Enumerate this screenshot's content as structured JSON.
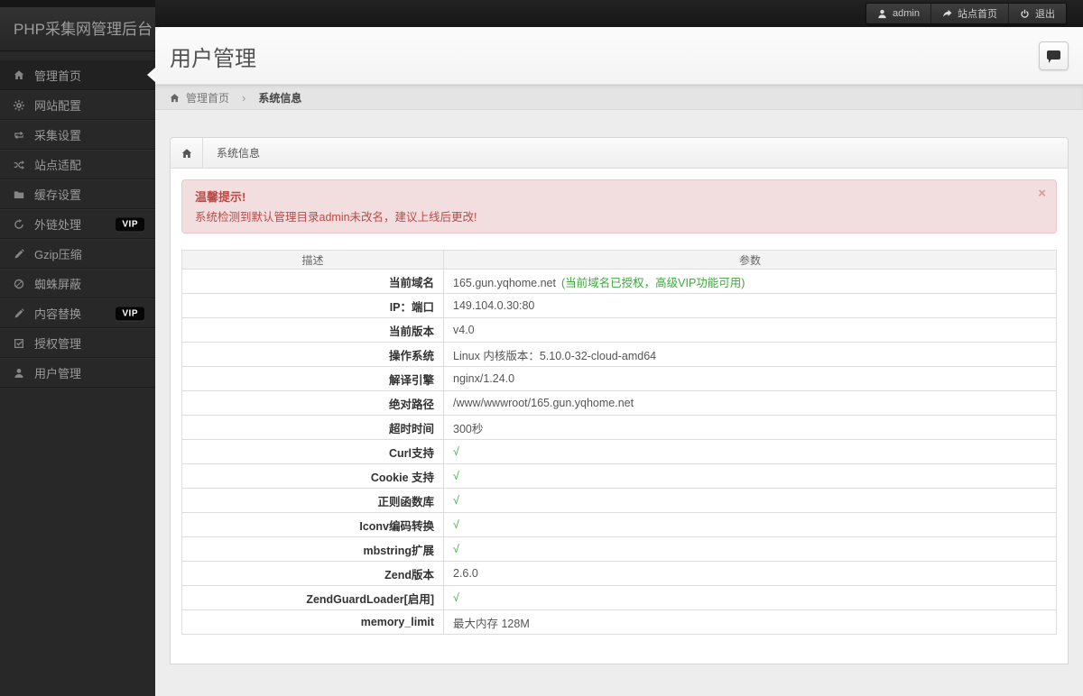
{
  "topbar": {
    "logo": "PHP采集网管理后台",
    "buttons": [
      {
        "label": "admin",
        "icon": "user-icon"
      },
      {
        "label": "站点首页",
        "icon": "share-icon"
      },
      {
        "label": "退出",
        "icon": "power-icon"
      }
    ]
  },
  "sidebar": {
    "items": [
      {
        "label": "管理首页",
        "icon": "home-icon",
        "active": true
      },
      {
        "label": "网站配置",
        "icon": "gear-icon"
      },
      {
        "label": "采集设置",
        "icon": "collect-icon"
      },
      {
        "label": "站点适配",
        "icon": "shuffle-icon"
      },
      {
        "label": "缓存设置",
        "icon": "folder-icon"
      },
      {
        "label": "外链处理",
        "icon": "refresh-icon",
        "badge": "VIP"
      },
      {
        "label": "Gzip压缩",
        "icon": "pencil-icon"
      },
      {
        "label": "蜘蛛屏蔽",
        "icon": "spider-block-icon"
      },
      {
        "label": "内容替换",
        "icon": "edit-icon",
        "badge": "VIP"
      },
      {
        "label": "授权管理",
        "icon": "license-icon"
      },
      {
        "label": "用户管理",
        "icon": "user-icon"
      }
    ]
  },
  "header": {
    "title": "用户管理"
  },
  "breadcrumb": {
    "home": "管理首页",
    "separator": "›",
    "current": "系统信息"
  },
  "panel": {
    "tab": "系统信息"
  },
  "alert": {
    "title": "温馨提示!",
    "message": "系统检测到默认管理目录admin未改名，建议上线后更改!",
    "close": "×"
  },
  "table": {
    "headers": [
      "描述",
      "参数"
    ],
    "rows": [
      {
        "label": "当前域名",
        "value": "165.gun.yqhome.net",
        "extra": "(当前域名已授权，高级VIP功能可用)"
      },
      {
        "label": "IP：端口",
        "value": "149.104.0.30:80"
      },
      {
        "label": "当前版本",
        "value": "v4.0"
      },
      {
        "label": "操作系统",
        "value": "Linux  内核版本：5.10.0-32-cloud-amd64"
      },
      {
        "label": "解译引擎",
        "value": "nginx/1.24.0"
      },
      {
        "label": "绝对路径",
        "value": "/www/wwwroot/165.gun.yqhome.net"
      },
      {
        "label": "超时时间",
        "value": "300秒"
      },
      {
        "label": "Curl支持",
        "value": "√",
        "check": true
      },
      {
        "label": "Cookie 支持",
        "value": "√",
        "check": true
      },
      {
        "label": "正则函数库",
        "value": "√",
        "check": true
      },
      {
        "label": "Iconv编码转换",
        "value": "√",
        "check": true
      },
      {
        "label": "mbstring扩展",
        "value": "√",
        "check": true
      },
      {
        "label": "Zend版本",
        "value": "2.6.0"
      },
      {
        "label": "ZendGuardLoader[启用]",
        "value": "√",
        "check": true
      },
      {
        "label": "memory_limit",
        "value": "最大内存 128M"
      }
    ]
  },
  "colors": {
    "accent_green": "#3fa63f",
    "alert_red": "#b94a48",
    "vip_badge_bg": "#000000",
    "sidebar_bg": "#282828"
  }
}
